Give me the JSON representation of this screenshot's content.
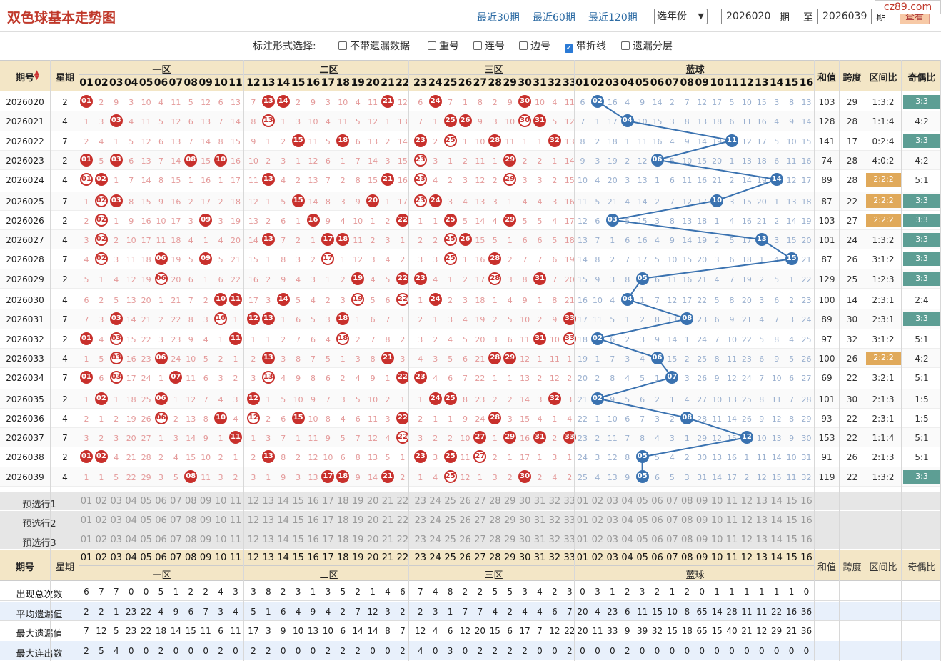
{
  "header": {
    "title": "双色球基本走势图",
    "recent_links": [
      "最近30期",
      "最近60期",
      "最近120期"
    ],
    "year_select": "选年份",
    "period_from": "2026020",
    "period_label": "期",
    "to_label": "至",
    "period_to": "2026039",
    "period_label2": "期",
    "view_button": "查看",
    "brand": "cz89.com"
  },
  "options": {
    "label": "标注形式选择:",
    "items": [
      {
        "label": "不带遗漏数据",
        "checked": false
      },
      {
        "label": "重号",
        "checked": false
      },
      {
        "label": "连号",
        "checked": false
      },
      {
        "label": "边号",
        "checked": false
      },
      {
        "label": "带折线",
        "checked": true
      },
      {
        "label": "遗漏分层",
        "checked": false
      }
    ]
  },
  "table": {
    "col_period": "期号",
    "col_week": "星期",
    "zones": [
      "一区",
      "二区",
      "三区",
      "蓝球"
    ],
    "col_sum": "和值",
    "col_span": "跨度",
    "col_zone_ratio": "区间比",
    "col_odd_even": "奇偶比",
    "red_numbers": [
      "01",
      "02",
      "03",
      "04",
      "05",
      "06",
      "07",
      "08",
      "09",
      "10",
      "11",
      "12",
      "13",
      "14",
      "15",
      "16",
      "17",
      "18",
      "19",
      "20",
      "21",
      "22",
      "23",
      "24",
      "25",
      "26",
      "27",
      "28",
      "29",
      "30",
      "31",
      "32",
      "33"
    ],
    "blue_numbers": [
      "01",
      "02",
      "03",
      "04",
      "05",
      "06",
      "07",
      "08",
      "09",
      "10",
      "11",
      "12",
      "13",
      "14",
      "15",
      "16"
    ],
    "rows": [
      {
        "period": "2026020",
        "week": "2",
        "red": [
          1,
          13,
          14,
          21,
          24,
          30
        ],
        "blue": 2,
        "sum": "103",
        "span": "29",
        "zone": "1:3:2",
        "oe": "3:3"
      },
      {
        "period": "2026021",
        "week": "4",
        "red": [
          3,
          13,
          25,
          26,
          30,
          31
        ],
        "blue": 4,
        "sum": "128",
        "span": "28",
        "zone": "1:1:4",
        "oe": "4:2"
      },
      {
        "period": "2026022",
        "week": "7",
        "red": [
          15,
          18,
          23,
          25,
          28,
          32
        ],
        "blue": 11,
        "sum": "141",
        "span": "17",
        "zone": "0:2:4",
        "oe": "3:3"
      },
      {
        "period": "2026023",
        "week": "2",
        "red": [
          1,
          3,
          8,
          10,
          23,
          29
        ],
        "blue": 6,
        "sum": "74",
        "span": "28",
        "zone": "4:0:2",
        "oe": "4:2"
      },
      {
        "period": "2026024",
        "week": "4",
        "red": [
          1,
          2,
          13,
          21,
          23,
          29
        ],
        "blue": 14,
        "sum": "89",
        "span": "28",
        "zone": "2:2:2",
        "oe": "5:1"
      },
      {
        "period": "2026025",
        "week": "7",
        "red": [
          2,
          3,
          15,
          20,
          23,
          24
        ],
        "blue": 10,
        "sum": "87",
        "span": "22",
        "zone": "2:2:2",
        "oe": "3:3"
      },
      {
        "period": "2026026",
        "week": "2",
        "red": [
          2,
          9,
          16,
          22,
          25,
          29
        ],
        "blue": 3,
        "sum": "103",
        "span": "27",
        "zone": "2:2:2",
        "oe": "3:3"
      },
      {
        "period": "2026027",
        "week": "4",
        "red": [
          2,
          13,
          17,
          18,
          25,
          26
        ],
        "blue": 13,
        "sum": "101",
        "span": "24",
        "zone": "1:3:2",
        "oe": "3:3"
      },
      {
        "period": "2026028",
        "week": "7",
        "red": [
          2,
          6,
          9,
          17,
          25,
          28
        ],
        "blue": 15,
        "sum": "87",
        "span": "26",
        "zone": "3:1:2",
        "oe": "3:3"
      },
      {
        "period": "2026029",
        "week": "2",
        "red": [
          6,
          19,
          22,
          23,
          28,
          31
        ],
        "blue": 5,
        "sum": "129",
        "span": "25",
        "zone": "1:2:3",
        "oe": "3:3"
      },
      {
        "period": "2026030",
        "week": "4",
        "red": [
          10,
          11,
          14,
          19,
          22,
          24
        ],
        "blue": 4,
        "sum": "100",
        "span": "14",
        "zone": "2:3:1",
        "oe": "2:4"
      },
      {
        "period": "2026031",
        "week": "7",
        "red": [
          3,
          10,
          12,
          13,
          18,
          33
        ],
        "blue": 8,
        "sum": "89",
        "span": "30",
        "zone": "2:3:1",
        "oe": "3:3"
      },
      {
        "period": "2026032",
        "week": "2",
        "red": [
          1,
          3,
          11,
          18,
          31,
          33
        ],
        "blue": 2,
        "sum": "97",
        "span": "32",
        "zone": "3:1:2",
        "oe": "5:1"
      },
      {
        "period": "2026033",
        "week": "4",
        "red": [
          3,
          6,
          13,
          21,
          28,
          29
        ],
        "blue": 6,
        "sum": "100",
        "span": "26",
        "zone": "2:2:2",
        "oe": "4:2"
      },
      {
        "period": "2026034",
        "week": "7",
        "red": [
          1,
          3,
          7,
          13,
          22,
          23
        ],
        "blue": 7,
        "sum": "69",
        "span": "22",
        "zone": "3:2:1",
        "oe": "5:1"
      },
      {
        "period": "2026035",
        "week": "2",
        "red": [
          2,
          6,
          12,
          24,
          25,
          32
        ],
        "blue": 2,
        "sum": "101",
        "span": "30",
        "zone": "2:1:3",
        "oe": "1:5"
      },
      {
        "period": "2026036",
        "week": "4",
        "red": [
          6,
          10,
          12,
          15,
          22,
          28
        ],
        "blue": 8,
        "sum": "93",
        "span": "22",
        "zone": "2:3:1",
        "oe": "1:5"
      },
      {
        "period": "2026037",
        "week": "7",
        "red": [
          11,
          22,
          27,
          29,
          31,
          33
        ],
        "blue": 12,
        "sum": "153",
        "span": "22",
        "zone": "1:1:4",
        "oe": "5:1"
      },
      {
        "period": "2026038",
        "week": "2",
        "red": [
          1,
          2,
          13,
          23,
          25,
          27
        ],
        "blue": 5,
        "sum": "91",
        "span": "26",
        "zone": "2:1:3",
        "oe": "5:1"
      },
      {
        "period": "2026039",
        "week": "4",
        "red": [
          8,
          17,
          18,
          21,
          25,
          30
        ],
        "blue": 5,
        "sum": "119",
        "span": "22",
        "zone": "1:3:2",
        "oe": "3:3"
      }
    ],
    "preselect": [
      "预选行1",
      "预选行2",
      "预选行3"
    ],
    "stats": [
      {
        "label": "出现总次数",
        "values": [
          "6",
          "7",
          "7",
          "0",
          "0",
          "5",
          "1",
          "2",
          "2",
          "4",
          "3",
          "3",
          "8",
          "2",
          "3",
          "1",
          "3",
          "5",
          "2",
          "1",
          "4",
          "6",
          "7",
          "4",
          "8",
          "2",
          "2",
          "5",
          "5",
          "3",
          "4",
          "2",
          "3",
          "0",
          "3",
          "1",
          "2",
          "3",
          "2",
          "1",
          "2",
          "0",
          "1",
          "1",
          "1",
          "1",
          "1",
          "1",
          "0"
        ]
      },
      {
        "label": "平均遗漏值",
        "values": [
          "2",
          "2",
          "1",
          "23",
          "22",
          "4",
          "9",
          "6",
          "7",
          "3",
          "4",
          "5",
          "1",
          "6",
          "4",
          "9",
          "4",
          "2",
          "7",
          "12",
          "3",
          "2",
          "2",
          "3",
          "1",
          "7",
          "7",
          "4",
          "2",
          "4",
          "4",
          "6",
          "7",
          "20",
          "4",
          "23",
          "6",
          "11",
          "15",
          "10",
          "8",
          "65",
          "14",
          "28",
          "11",
          "11",
          "22",
          "16",
          "36"
        ]
      },
      {
        "label": "最大遗漏值",
        "values": [
          "7",
          "12",
          "5",
          "23",
          "22",
          "18",
          "14",
          "15",
          "11",
          "6",
          "11",
          "17",
          "3",
          "9",
          "10",
          "13",
          "10",
          "6",
          "14",
          "14",
          "8",
          "7",
          "12",
          "4",
          "6",
          "12",
          "20",
          "15",
          "6",
          "17",
          "7",
          "12",
          "22",
          "20",
          "11",
          "33",
          "9",
          "39",
          "32",
          "15",
          "18",
          "65",
          "15",
          "40",
          "21",
          "12",
          "29",
          "21",
          "36"
        ]
      },
      {
        "label": "最大连出数",
        "values": [
          "2",
          "5",
          "4",
          "0",
          "0",
          "2",
          "0",
          "0",
          "0",
          "2",
          "0",
          "2",
          "2",
          "0",
          "0",
          "0",
          "2",
          "2",
          "2",
          "0",
          "0",
          "2",
          "4",
          "0",
          "3",
          "0",
          "2",
          "2",
          "2",
          "2",
          "0",
          "0",
          "2",
          "0",
          "0",
          "0",
          "2",
          "0",
          "0",
          "0",
          "0",
          "0",
          "0",
          "0",
          "0",
          "0",
          "0",
          "0",
          "0"
        ]
      }
    ]
  }
}
